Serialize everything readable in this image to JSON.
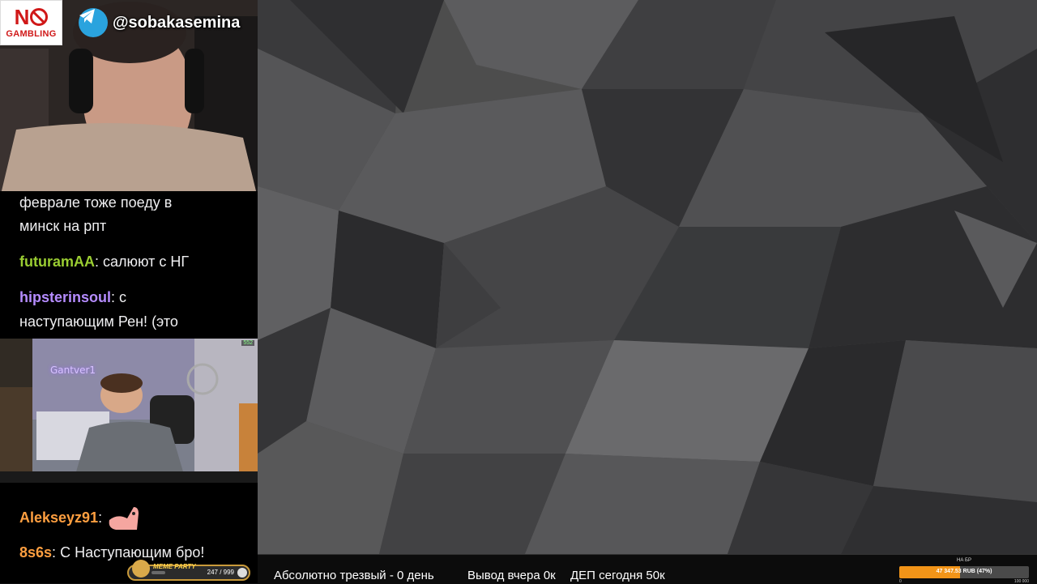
{
  "overlay": {
    "no_gambling": {
      "no_text": "N",
      "gambling_text": "GAMBLING",
      "color": "#d01818"
    },
    "telegram_handle": "@sobakasemina",
    "telegram_color": "#2aa3de"
  },
  "chat_top": [
    {
      "user": "",
      "user_color": "",
      "text": "феврале тоже поеду в"
    },
    {
      "user": "",
      "user_color": "",
      "text": "минск на рпт"
    },
    {
      "user": "futuramAA",
      "user_color": "#9acd32",
      "text": " салюют с НГ"
    },
    {
      "user": "hipsterinsoul",
      "user_color": "#b58cff",
      "text": " с"
    },
    {
      "user": "",
      "user_color": "",
      "text": "наступающим Рен! (это"
    }
  ],
  "embed_stream": {
    "neon_sign": "Gantver1",
    "viewers": "552"
  },
  "chat_bottom": [
    {
      "user": "Alekseyz91",
      "user_color": "#ff9f40",
      "text": ""
    },
    {
      "user": "8s6s",
      "user_color": "#ff9f40",
      "text": " С Наступающим бро!"
    }
  ],
  "meme_party": {
    "label": "MEME PARTY",
    "count": "247 / 999",
    "progress": 0.247
  },
  "ticker": {
    "sober": "Абсолютно трезвый - 0 день",
    "withdraw": "Вывод вчера 0к",
    "deposit": "ДЕП сегодня 50к"
  },
  "goal": {
    "title": "НА БР",
    "value": "47 347.53 RUB (47%)",
    "progress": 0.47,
    "min": "0",
    "max": "100 000",
    "color": "#f29418"
  }
}
